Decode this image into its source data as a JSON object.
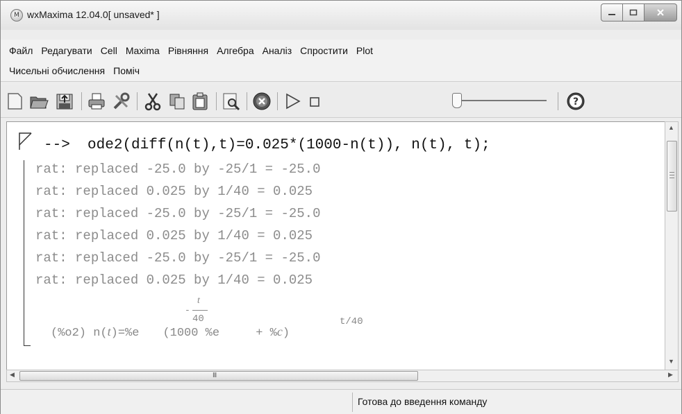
{
  "window": {
    "title": "wxMaxima 12.04.0[ unsaved* ]",
    "app_icon_letter": "M"
  },
  "menu": {
    "row1": [
      "Файл",
      "Редагувати",
      "Cell",
      "Maxima",
      "Рівняння",
      "Алгебра",
      "Аналіз",
      "Спростити",
      "Plot"
    ],
    "row2": [
      "Чисельні обчислення",
      "Поміч"
    ]
  },
  "toolbar": {
    "icons": [
      "new-icon",
      "open-icon",
      "save-icon",
      "print-icon",
      "preferences-icon",
      "cut-icon",
      "copy-icon",
      "paste-icon",
      "find-icon",
      "interrupt-icon",
      "play-icon",
      "stop-icon",
      "help-icon"
    ],
    "slider_level": 0
  },
  "cell": {
    "prompt": "-->",
    "input": "ode2(diff(n(t),t)=0.025*(1000-n(t)), n(t), t);",
    "messages": [
      "rat: replaced -25.0 by -25/1 = -25.0",
      "rat: replaced 0.025 by 1/40 = 0.025",
      "rat: replaced -25.0 by -25/1 = -25.0",
      "rat: replaced 0.025 by 1/40 = 0.025",
      "rat: replaced -25.0 by -25/1 = -25.0",
      "rat: replaced 0.025 by 1/40 = 0.025"
    ],
    "output_label": "(%o2)",
    "output_lhs": "n(",
    "output_t": "t",
    "output_eq": ")=%e",
    "exp_num": "t",
    "exp_minus": "-",
    "exp_den": "40",
    "output_paren_open": "(1000 %e",
    "inner_exp": "t/40",
    "output_plus": " + %",
    "output_c": "c",
    "output_paren_close": ")"
  },
  "hscroll": {
    "grip": "III"
  },
  "status": {
    "text": "Готова до введення команду"
  },
  "colors": {
    "text_gray": "#8c8c8c",
    "input_text": "#111111"
  }
}
